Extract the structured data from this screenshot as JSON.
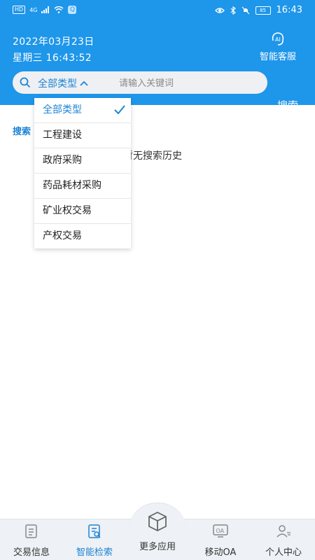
{
  "statusbar": {
    "hd": "HD",
    "signal": "4G",
    "q": "Q",
    "battery": "85",
    "time": "16:43"
  },
  "header": {
    "date": "2022年03月23日",
    "weekday_time": "星期三 16:43:52",
    "ai_service_label": "智能客服"
  },
  "search": {
    "type_selected": "全部类型",
    "placeholder": "请输入关键词",
    "button_label": "搜索"
  },
  "history": {
    "title": "搜索",
    "empty_text": "暂无搜索历史"
  },
  "dropdown": {
    "items": [
      "全部类型",
      "工程建设",
      "政府采购",
      "药品耗材采购",
      "矿业权交易",
      "产权交易"
    ],
    "selected_index": 0
  },
  "bottomnav": {
    "items": [
      {
        "label": "交易信息",
        "icon": "document-icon"
      },
      {
        "label": "智能检索",
        "icon": "search-doc-icon"
      },
      {
        "label": "更多应用",
        "icon": "cube-icon"
      },
      {
        "label": "移动OA",
        "icon": "oa-icon"
      },
      {
        "label": "个人中心",
        "icon": "user-icon"
      }
    ],
    "active_index": 1
  },
  "colors": {
    "primary": "#1e96ea",
    "accent_text": "#1e84d4",
    "nav_bg": "#eef1f5"
  }
}
